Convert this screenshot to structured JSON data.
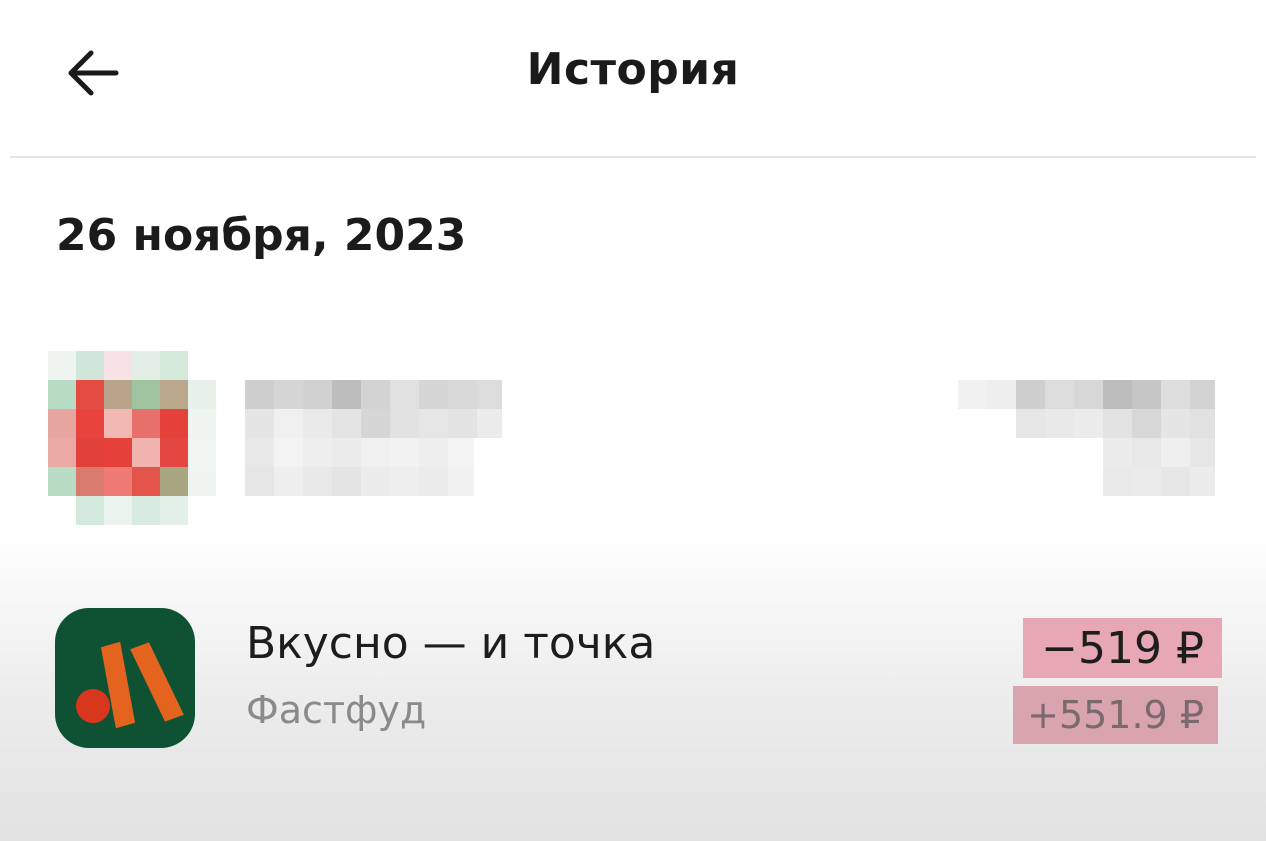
{
  "header": {
    "title": "История",
    "back_icon": "arrow-left-icon"
  },
  "date_group": {
    "date": "26 ноября, 2023"
  },
  "transactions": [
    {
      "name": "Вкусно — и точка",
      "category": "Фастфуд",
      "amount": "−519 ₽",
      "bonus": "+551.9 ₽",
      "logo_icon": "vkusno-i-tochka-logo-icon"
    }
  ],
  "colors": {
    "logo_bg": "#0f5233",
    "logo_orange": "#e4641f",
    "logo_red": "#d8361d",
    "amount_highlight": "#e7a7b4",
    "bonus_highlight": "#d9a4ad"
  }
}
